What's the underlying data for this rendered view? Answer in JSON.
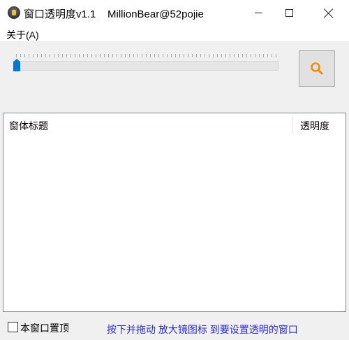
{
  "window": {
    "title": "窗口透明度v1.1    MillionBear@52pojie",
    "icon": "bear-app-icon"
  },
  "menu": {
    "items": [
      {
        "label": "关于(A)"
      }
    ]
  },
  "slider": {
    "value_fraction": 0.0
  },
  "search_button": {
    "icon": "magnifier-icon",
    "color": "#f08c00"
  },
  "list": {
    "columns": [
      {
        "label": "窗体标题"
      },
      {
        "label": "透明度"
      }
    ],
    "rows": []
  },
  "footer": {
    "topmost_label": "本窗口置顶",
    "topmost_checked": false,
    "hint": "按下并拖动 放大镜图标 到要设置透明的窗口",
    "hint_color": "#2a2adc"
  }
}
